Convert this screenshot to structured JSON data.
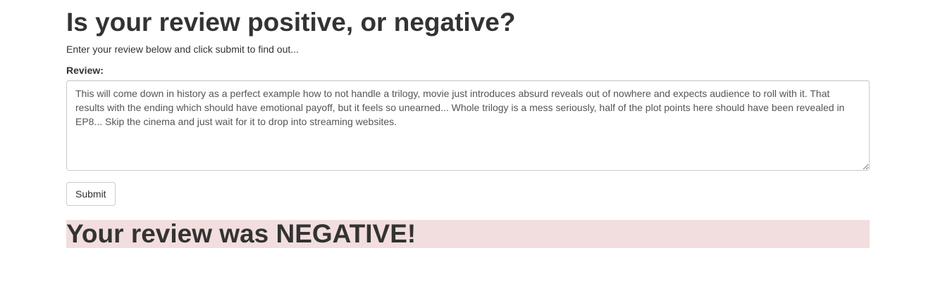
{
  "page": {
    "title": "Is your review positive, or negative?",
    "subtitle": "Enter your review below and click submit to find out..."
  },
  "form": {
    "review_label": "Review:",
    "review_value": "This will come down in history as a perfect example how to not handle a trilogy, movie just introduces absurd reveals out of nowhere and expects audience to roll with it. That results with the ending which should have emotional payoff, but it feels so unearned... Whole trilogy is a mess seriously, half of the plot points here should have been revealed in EP8... Skip the cinema and just wait for it to drop into streaming websites.",
    "submit_label": "Submit"
  },
  "result": {
    "text": "Your review was NEGATIVE!",
    "banner_color": "#f2dede"
  }
}
